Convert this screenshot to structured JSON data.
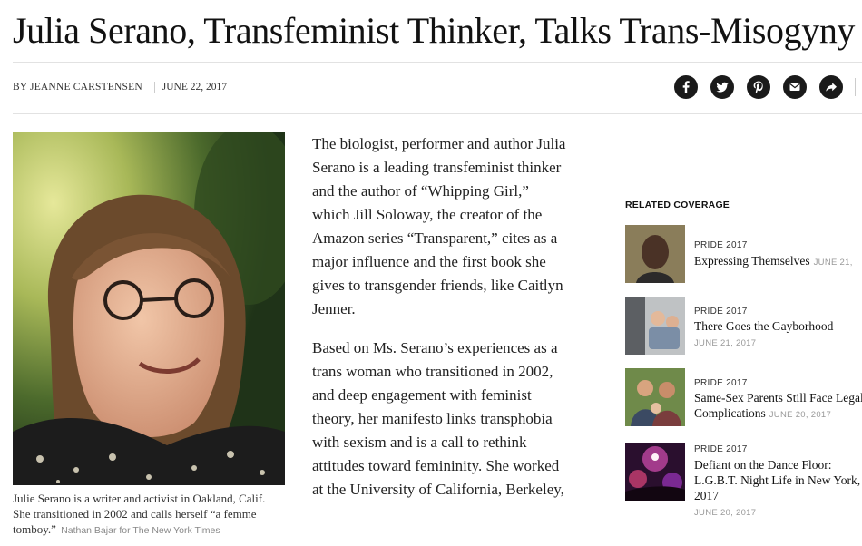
{
  "article": {
    "headline": "Julia Serano, Transfeminist Thinker, Talks Trans-Misogyny",
    "byline_author": "By JEANNE CARSTENSEN",
    "byline_date": "JUNE 22, 2017",
    "paragraphs": [
      "The biologist, performer and author Julia Serano is a leading transfeminist thinker and the author of “Whipping Girl,” which Jill Soloway, the creator of the Amazon series “Transparent,” cites as a major influence and the first book she gives to transgender friends, like Caitlyn Jenner.",
      "Based on Ms. Serano’s experiences as a trans woman who transitioned in 2002, and deep engagement with feminist theory, her manifesto links transphobia with sexism and is a call to rethink attitudes toward femininity. She worked at the University of California, Berkeley,"
    ],
    "caption": "Julie Serano is a writer and activist in Oakland, Calif. She transitioned in 2002 and calls herself “a femme tomboy.”",
    "photo_credit": "Nathan Bajar for The New York Times"
  },
  "share": {
    "icons": [
      "facebook-icon",
      "twitter-icon",
      "pinterest-icon",
      "email-icon",
      "share-arrow-icon"
    ]
  },
  "related": {
    "heading": "RELATED COVERAGE",
    "items": [
      {
        "kicker": "PRIDE 2017",
        "title": "Expressing Themselves",
        "date": "JUNE 21,"
      },
      {
        "kicker": "PRIDE 2017",
        "title": "There Goes the Gayborhood",
        "date": "JUNE 21, 2017"
      },
      {
        "kicker": "PRIDE 2017",
        "title": "Same-Sex Parents Still Face Legal Complications",
        "date": "JUNE 20, 2017"
      },
      {
        "kicker": "PRIDE 2017",
        "title": "Defiant on the Dance Floor: L.G.B.T. Night Life in New York, 2017",
        "date": "JUNE 20, 2017"
      }
    ]
  },
  "colors": {
    "text": "#121212",
    "muted": "#999999",
    "share_bg": "#1a1a1a",
    "rule": "#e2e2e2"
  }
}
